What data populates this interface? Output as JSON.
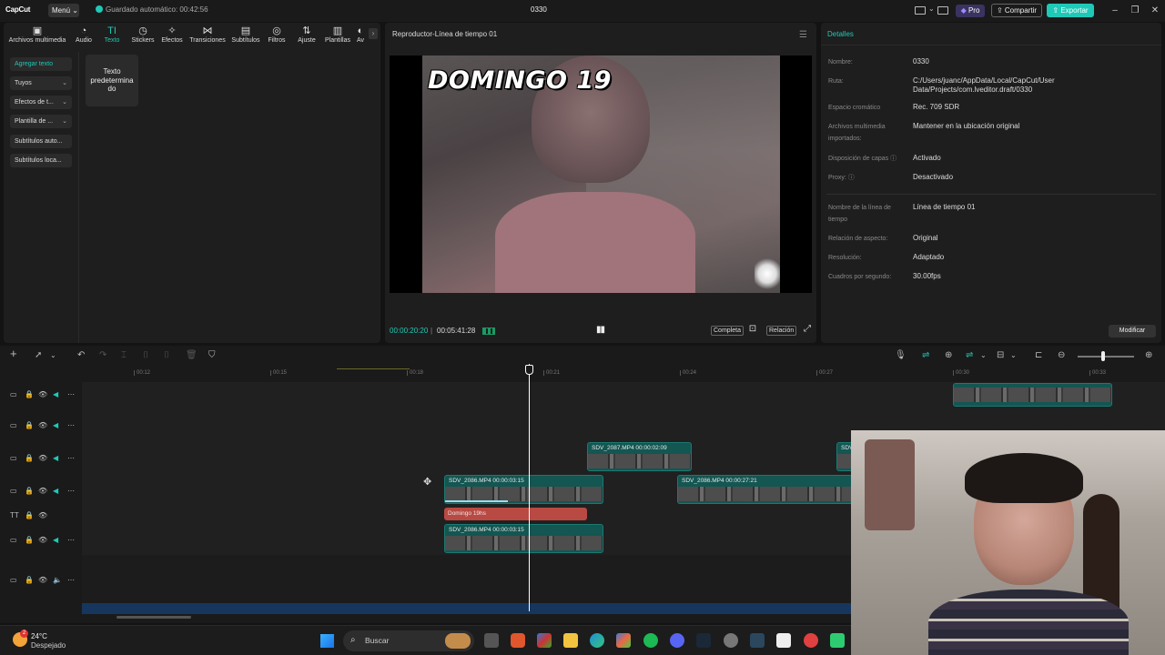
{
  "titlebar": {
    "logo": "CapCut",
    "menu_label": "Menú",
    "autosave": "Guardado automático: 00:42:56",
    "project_name": "0330",
    "pro_label": "Pro",
    "share_label": "Compartir",
    "export_label": "Exportar"
  },
  "media_tabs": [
    {
      "label": "Archivos multimedia",
      "icon": "media-icon",
      "glyph": "▣"
    },
    {
      "label": "Audio",
      "icon": "audio-icon",
      "glyph": "◔"
    },
    {
      "label": "Texto",
      "icon": "text-icon",
      "glyph": "TI"
    },
    {
      "label": "Stickers",
      "icon": "sticker-icon",
      "glyph": "◷"
    },
    {
      "label": "Efectos",
      "icon": "effects-icon",
      "glyph": "✧"
    },
    {
      "label": "Transiciones",
      "icon": "transition-icon",
      "glyph": "⋈"
    },
    {
      "label": "Subtítulos",
      "icon": "subtitles-icon",
      "glyph": "▤"
    },
    {
      "label": "Filtros",
      "icon": "filters-icon",
      "glyph": "◎"
    },
    {
      "label": "Ajuste",
      "icon": "adjust-icon",
      "glyph": "⇅"
    },
    {
      "label": "Plantillas",
      "icon": "templates-icon",
      "glyph": "▥"
    },
    {
      "label": "Av",
      "icon": "avatar-icon",
      "glyph": "◐"
    }
  ],
  "sidebar": {
    "items": [
      {
        "label": "Agregar texto"
      },
      {
        "label": "Tuyos"
      },
      {
        "label": "Efectos de t..."
      },
      {
        "label": "Plantilla de ..."
      },
      {
        "label": "Subtítulos auto..."
      },
      {
        "label": "Subtítulos loca..."
      }
    ]
  },
  "text_card": {
    "label": "Texto predetermina do"
  },
  "player": {
    "title": "Reproductor-Línea de tiempo 01",
    "overlay_text": "DOMINGO 19",
    "current_time": "00:00:20:20",
    "separator": "|",
    "duration": "00:05:41:28",
    "full_label": "Completa",
    "ratio_label": "Relación"
  },
  "details": {
    "title": "Detalles",
    "rows": [
      {
        "label": "Nombre:",
        "value": "0330"
      },
      {
        "label": "Ruta:",
        "value": "C:/Users/juanc/AppData/Local/CapCut/User Data/Projects/com.lveditor.draft/0330"
      },
      {
        "label": "Espacio cromático",
        "value": "Rec. 709 SDR"
      },
      {
        "label": "Archivos multimedia importados:",
        "value": "Mantener en la ubicación original"
      },
      {
        "label": "Disposición de capas",
        "value": "Activado"
      },
      {
        "label": "Proxy:",
        "value": "Desactivado"
      },
      {
        "label": "Nombre de la línea de tiempo",
        "value": "Línea de tiempo 01"
      },
      {
        "label": "Relación de aspecto:",
        "value": "Original"
      },
      {
        "label": "Resolución:",
        "value": "Adaptado"
      },
      {
        "label": "Cuadros por segundo:",
        "value": "30.00fps"
      }
    ],
    "modify_label": "Modificar"
  },
  "timeline": {
    "ruler_ticks": [
      "00:12",
      "00:15",
      "00:18",
      "00:21",
      "00:24",
      "00:27",
      "00:30",
      "00:33"
    ],
    "clips": [
      {
        "label": "SDV_2087.MP4   00:00:02:09"
      },
      {
        "label": "SDV_2086.MP4   00:00:03:15"
      },
      {
        "label": "SDV_2086.MP4   00:00:27:21"
      },
      {
        "label": "SDV_2086.MP4   00:00:03:15"
      },
      {
        "label": ""
      },
      {
        "label": "SDV"
      }
    ],
    "text_clip": {
      "label": "Domingo 19hs"
    }
  },
  "taskbar": {
    "temperature": "24°C",
    "condition": "Despejado",
    "weather_badge": "2",
    "search_placeholder": "Buscar"
  },
  "colors": {
    "accent": "#1fc9b7",
    "clip": "#135652",
    "text_clip": "#b84a43",
    "panel": "#1e1e1e",
    "background": "#131313"
  }
}
